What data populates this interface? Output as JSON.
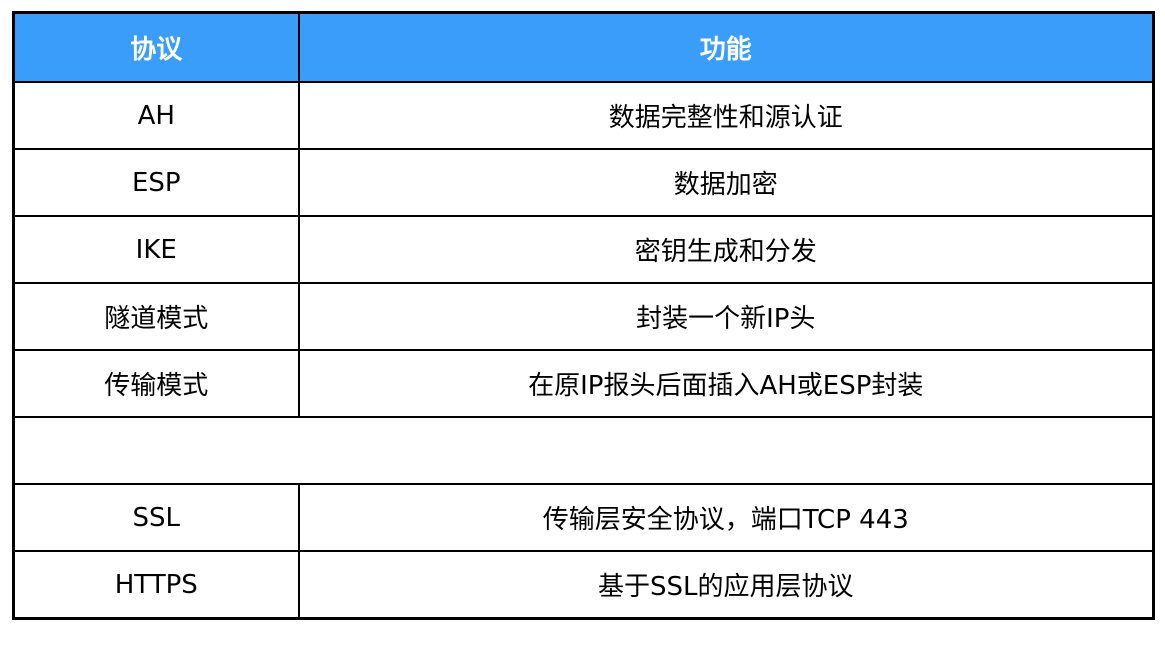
{
  "table": {
    "header": {
      "protocol": "协议",
      "function": "功能"
    },
    "rows": [
      {
        "protocol": "AH",
        "function": "数据完整性和源认证"
      },
      {
        "protocol": "ESP",
        "function": "数据加密"
      },
      {
        "protocol": "IKE",
        "function": "密钥生成和分发"
      },
      {
        "protocol": "隧道模式",
        "function": "封装一个新IP头"
      },
      {
        "protocol": "传输模式",
        "function": "在原IP报头后面插入AH或ESP封装"
      }
    ],
    "separator_row": "",
    "rows2": [
      {
        "protocol": "SSL",
        "function": "传输层安全协议，端口TCP 443"
      },
      {
        "protocol": "HTTPS",
        "function": "基于SSL的应用层协议"
      }
    ]
  },
  "colors": {
    "header_bg": "#3a9dfa",
    "header_text": "#ffffff",
    "border": "#000000"
  }
}
